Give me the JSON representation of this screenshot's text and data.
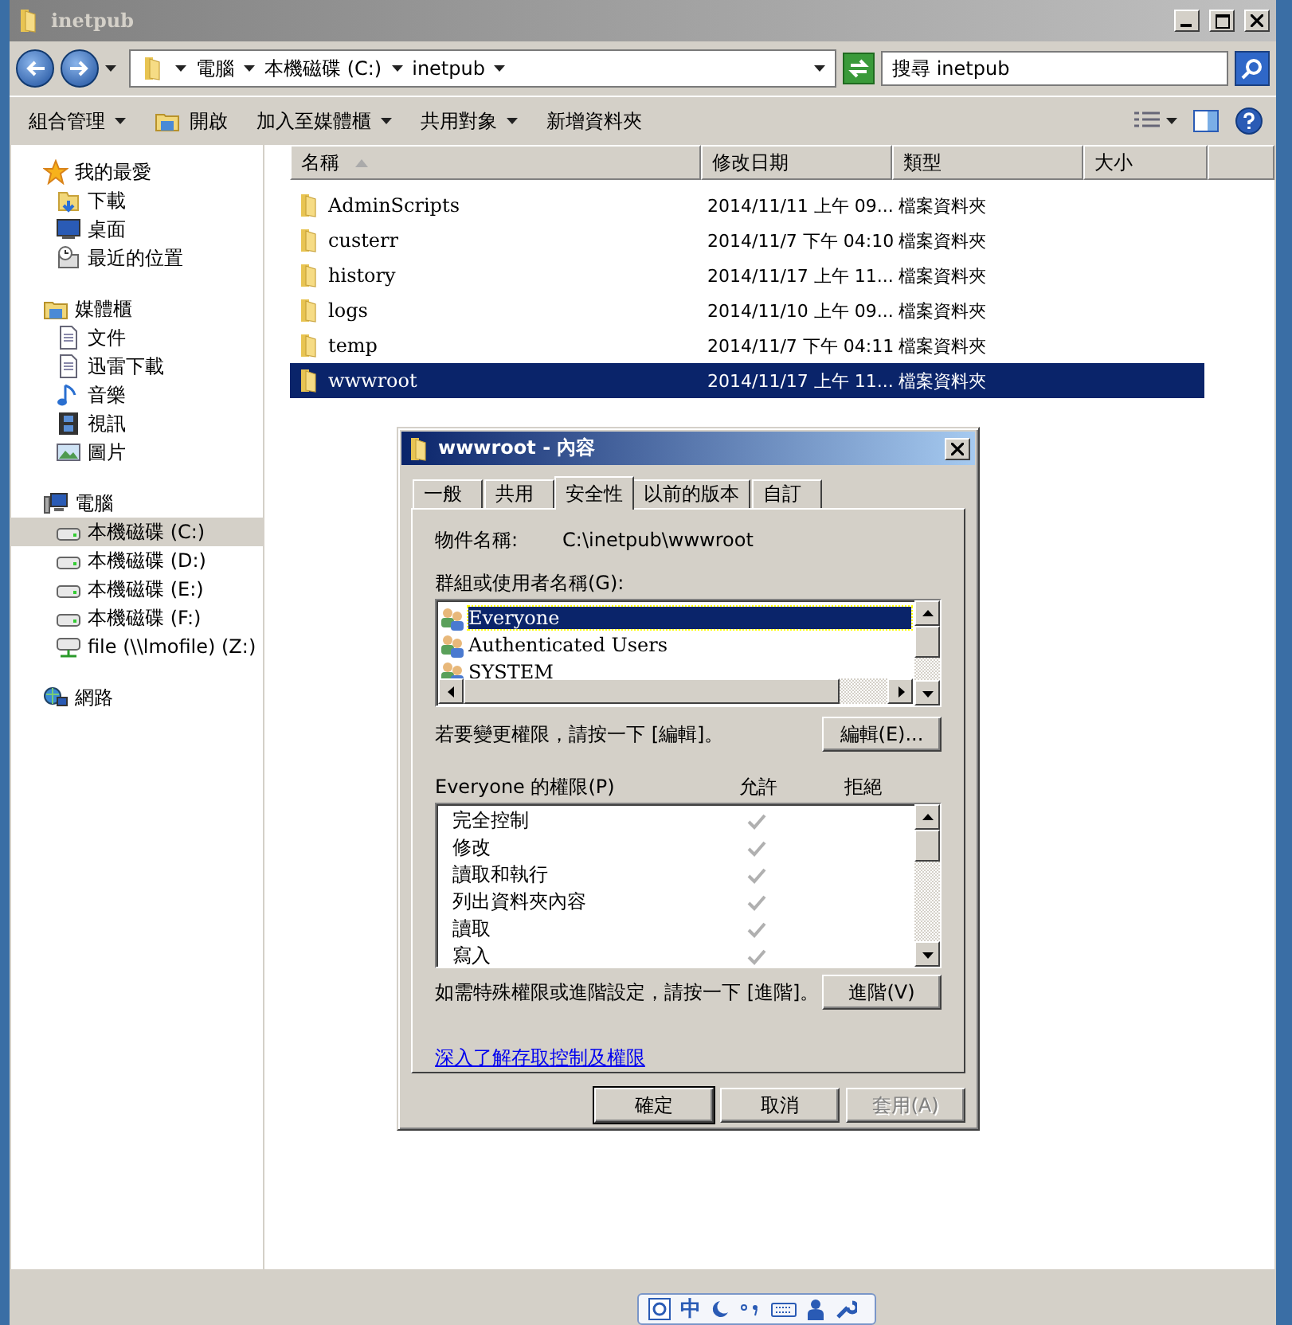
{
  "window": {
    "title": "inetpub"
  },
  "address_bar": {
    "breadcrumbs": [
      "電腦",
      "本機磁碟 (C:)",
      "inetpub"
    ]
  },
  "search": {
    "placeholder": "搜尋 inetpub"
  },
  "toolbar": {
    "items": [
      {
        "label": "組合管理",
        "kind": "menu"
      },
      {
        "label": "開啟",
        "kind": "open"
      },
      {
        "label": "加入至媒體櫃",
        "kind": "menu"
      },
      {
        "label": "共用對象",
        "kind": "menu"
      },
      {
        "label": "新增資料夾",
        "kind": "plain"
      }
    ]
  },
  "sidebar": {
    "groups": [
      {
        "label": "我的最愛",
        "kind": "star",
        "selected": false,
        "children": [
          {
            "label": "下載",
            "kind": "folder",
            "selected": false
          },
          {
            "label": "桌面",
            "kind": "monitor",
            "selected": false
          },
          {
            "label": "最近的位置",
            "kind": "recent",
            "selected": false
          }
        ]
      },
      {
        "label": "媒體櫃",
        "kind": "library",
        "selected": false,
        "children": [
          {
            "label": "文件",
            "kind": "document",
            "selected": false
          },
          {
            "label": "迅雷下載",
            "kind": "document",
            "selected": false
          },
          {
            "label": "音樂",
            "kind": "music",
            "selected": false
          },
          {
            "label": "視訊",
            "kind": "video",
            "selected": false
          },
          {
            "label": "圖片",
            "kind": "picture",
            "selected": false
          }
        ]
      },
      {
        "label": "電腦",
        "kind": "computer",
        "selected": false,
        "children": [
          {
            "label": "本機磁碟 (C:)",
            "kind": "drive",
            "selected": true
          },
          {
            "label": "本機磁碟 (D:)",
            "kind": "drive",
            "selected": false
          },
          {
            "label": "本機磁碟 (E:)",
            "kind": "drive",
            "selected": false
          },
          {
            "label": "本機磁碟 (F:)",
            "kind": "drive",
            "selected": false
          },
          {
            "label": "file (\\\\lmofile) (Z:)",
            "kind": "network-drive",
            "selected": false
          }
        ]
      },
      {
        "label": "網路",
        "kind": "network",
        "selected": false
      }
    ]
  },
  "file_list": {
    "columns": [
      "名稱",
      "修改日期",
      "類型",
      "大小"
    ],
    "rows": [
      {
        "name": "AdminScripts",
        "modified": "2014/11/11 上午 09...",
        "type": "檔案資料夾",
        "selected": false
      },
      {
        "name": "custerr",
        "modified": "2014/11/7 下午 04:10",
        "type": "檔案資料夾",
        "selected": false
      },
      {
        "name": "history",
        "modified": "2014/11/17 上午 11...",
        "type": "檔案資料夾",
        "selected": false
      },
      {
        "name": "logs",
        "modified": "2014/11/10 上午 09...",
        "type": "檔案資料夾",
        "selected": false
      },
      {
        "name": "temp",
        "modified": "2014/11/7 下午 04:11",
        "type": "檔案資料夾",
        "selected": false
      },
      {
        "name": "wwwroot",
        "modified": "2014/11/17 上午 11...",
        "type": "檔案資料夾",
        "selected": true
      }
    ]
  },
  "dialog": {
    "title": "wwwroot - 內容",
    "tabs": [
      {
        "label": "一般",
        "selected": false
      },
      {
        "label": "共用",
        "selected": false
      },
      {
        "label": "安全性",
        "selected": true
      },
      {
        "label": "以前的版本",
        "selected": false
      },
      {
        "label": "自訂",
        "selected": false
      }
    ],
    "object_name_label": "物件名稱:",
    "object_name": "C:\\inetpub\\wwwroot",
    "users_label": "群組或使用者名稱(G):",
    "users": [
      {
        "name": "Everyone",
        "selected": true
      },
      {
        "name": "Authenticated Users",
        "selected": false
      },
      {
        "name": "SYSTEM",
        "selected": false
      }
    ],
    "change_hint": "若要變更權限，請按一下 [編輯]。",
    "edit_button": "編輯(E)...",
    "permissions_label": "Everyone 的權限(P)",
    "allow_header": "允許",
    "deny_header": "拒絕",
    "permissions": [
      {
        "name": "完全控制",
        "allow": true,
        "deny": false
      },
      {
        "name": "修改",
        "allow": true,
        "deny": false
      },
      {
        "name": "讀取和執行",
        "allow": true,
        "deny": false
      },
      {
        "name": "列出資料夾內容",
        "allow": true,
        "deny": false
      },
      {
        "name": "讀取",
        "allow": true,
        "deny": false
      },
      {
        "name": "寫入",
        "allow": true,
        "deny": false
      }
    ],
    "advanced_hint": "如需特殊權限或進階設定，請按一下 [進階]。",
    "advanced_button": "進階(V)",
    "link": "深入了解存取控制及權限",
    "buttons": [
      {
        "label": "確定",
        "disabled": false
      },
      {
        "label": "取消",
        "disabled": false
      },
      {
        "label": "套用(A)",
        "disabled": true
      }
    ]
  },
  "ime_bar": {
    "mode": "中"
  }
}
